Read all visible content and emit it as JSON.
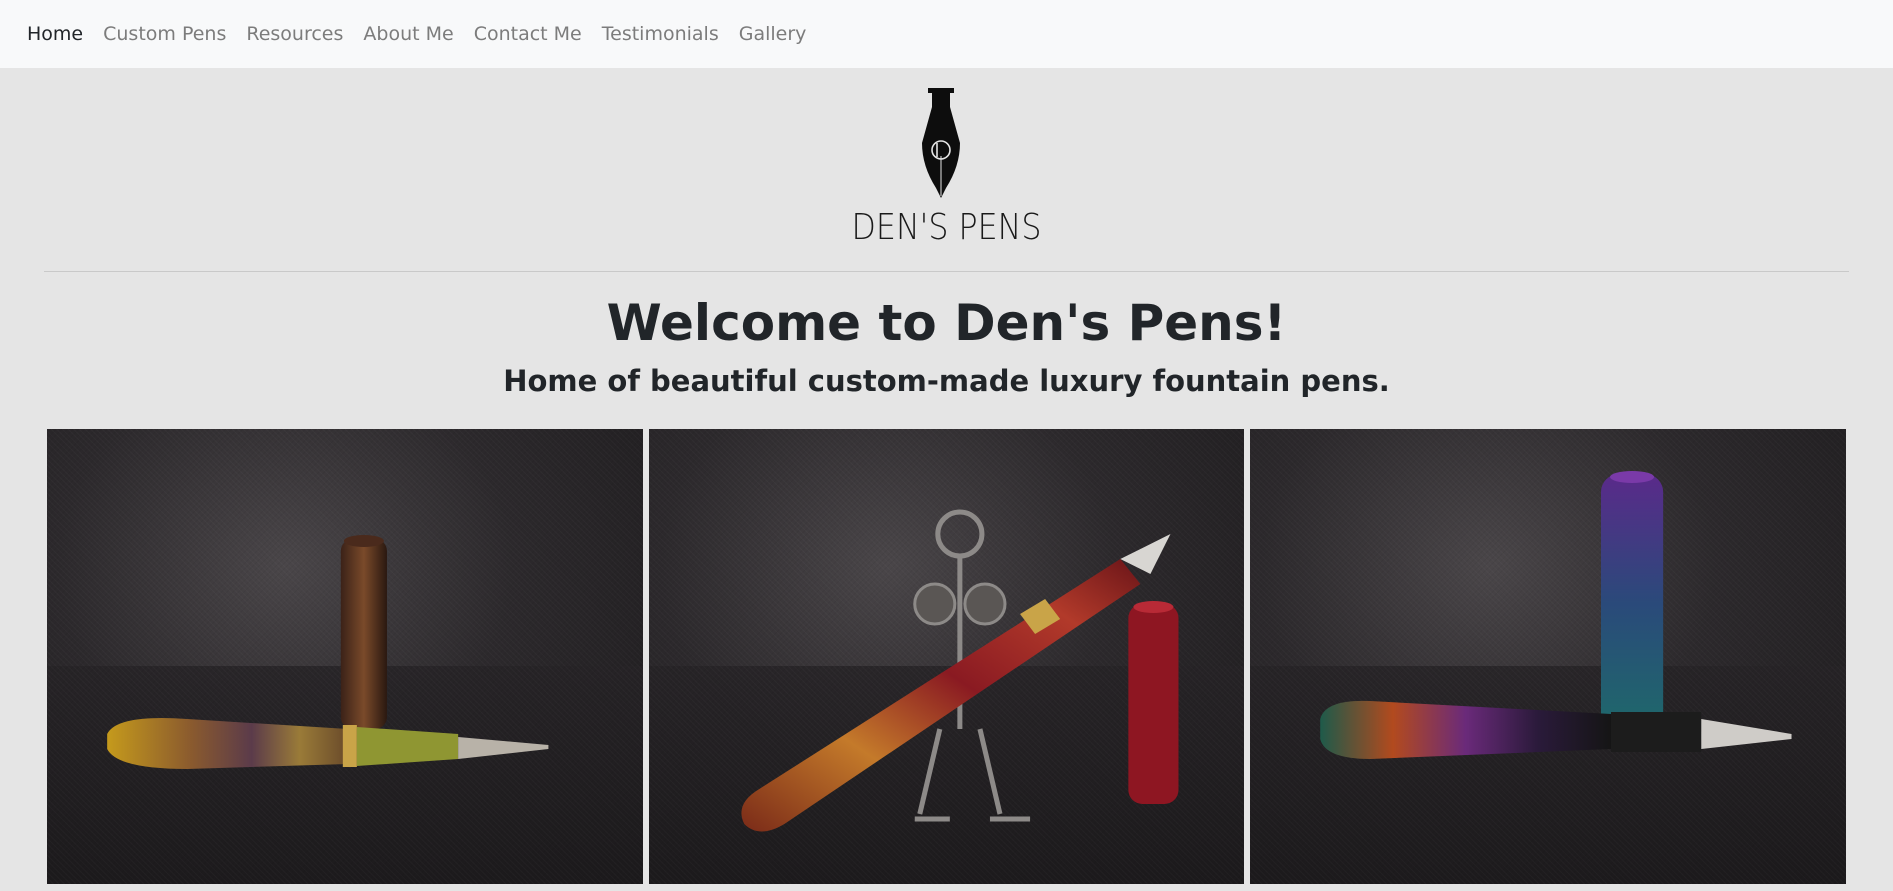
{
  "nav": {
    "items": [
      {
        "label": "Home",
        "active": true
      },
      {
        "label": "Custom Pens",
        "active": false
      },
      {
        "label": "Resources",
        "active": false
      },
      {
        "label": "About Me",
        "active": false
      },
      {
        "label": "Contact Me",
        "active": false
      },
      {
        "label": "Testimonials",
        "active": false
      },
      {
        "label": "Gallery",
        "active": false
      }
    ]
  },
  "header": {
    "logo_icon": "fountain-pen-nib-logo",
    "brand": "DEN'S PENS"
  },
  "hero": {
    "title": "Welcome to Den's Pens!",
    "subtitle": "Home of beautiful custom-made luxury fountain pens."
  },
  "gallery": {
    "photos": [
      {
        "subject": "amber-swirl-fountain-pen-with-cap"
      },
      {
        "subject": "red-gold-fountain-pen-with-metal-figure"
      },
      {
        "subject": "rainbow-fountain-pen-with-purple-cap"
      }
    ]
  },
  "colors": {
    "navbar_bg": "#f8f9fa",
    "page_bg": "#e5e5e5",
    "nav_link": "#7c7c7c",
    "nav_active": "#212529",
    "text": "#212529"
  }
}
